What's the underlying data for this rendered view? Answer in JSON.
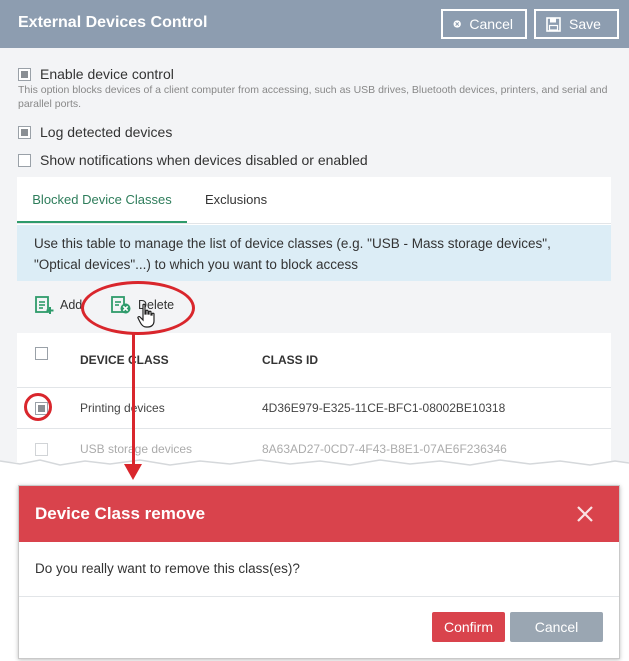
{
  "header": {
    "title": "External Devices Control",
    "cancel_label": "Cancel",
    "save_label": "Save",
    "bg_color": "#8d9db0"
  },
  "options": {
    "enable_device_control": {
      "label": "Enable device control",
      "checked": true
    },
    "description": "This option blocks devices of a client computer from accessing, such as USB drives, Bluetooth devices, printers, and serial and parallel ports.",
    "log_detected_devices": {
      "label": "Log detected devices",
      "checked": true
    },
    "show_notifications": {
      "label": "Show notifications when devices disabled or enabled",
      "checked": false
    }
  },
  "tabs": [
    {
      "label": "Blocked Device Classes",
      "active": true
    },
    {
      "label": "Exclusions",
      "active": false
    }
  ],
  "info_text": "Use this table to manage the list of device classes (e.g. \"USB - Mass storage devices\", \"Optical devices\"...) to which you want to block access",
  "toolbar": {
    "add_label": "Add",
    "delete_label": "Delete",
    "icon_color": "#2e9b6b"
  },
  "table": {
    "columns": [
      "DEVICE CLASS",
      "CLASS ID"
    ],
    "rows": [
      {
        "device_class": "Printing devices",
        "class_id": "4D36E979-E325-11CE-BFC1-08002BE10318",
        "checked": true
      },
      {
        "device_class": "USB storage devices",
        "class_id": "8A63AD27-0CD7-4F43-B8E1-07AE6F236346",
        "checked": false
      }
    ]
  },
  "modal": {
    "title": "Device Class remove",
    "message": "Do you really want to remove this class(es)?",
    "confirm_label": "Confirm",
    "cancel_label": "Cancel",
    "accent_color": "#d9434c"
  },
  "annotation_color": "#d9262c"
}
